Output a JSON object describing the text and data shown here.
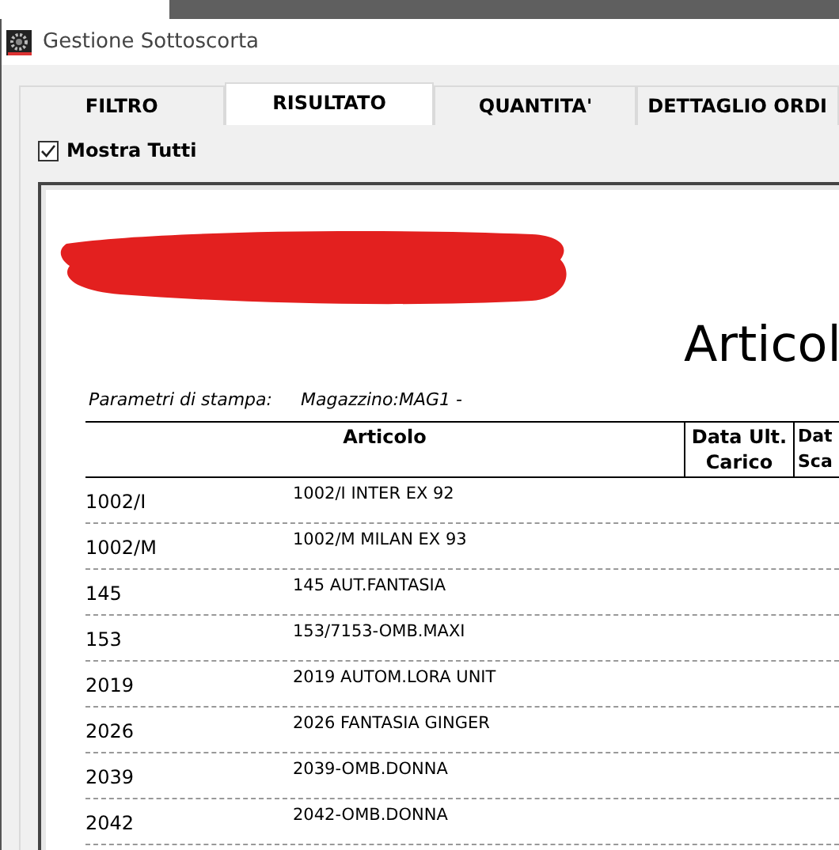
{
  "window": {
    "title": "Gestione Sottoscorta"
  },
  "tabs": [
    {
      "label": "FILTRO",
      "selected": false
    },
    {
      "label": "RISULTATO",
      "selected": true
    },
    {
      "label": "QUANTITA'",
      "selected": false
    },
    {
      "label": "DETTAGLIO ORDI",
      "selected": false
    }
  ],
  "show_all": {
    "label": "Mostra Tutti",
    "checked": true
  },
  "report": {
    "title": "Articol",
    "params_label": "Parametri di stampa:",
    "params_value": "Magazzino:MAG1  -",
    "columns": [
      {
        "lines": [
          "Articolo"
        ]
      },
      {
        "lines": [
          "Data Ult.",
          "Carico"
        ]
      },
      {
        "lines": [
          "Dat",
          "Sca"
        ]
      }
    ],
    "rows": [
      {
        "code": "1002/I",
        "description": "1002/I INTER EX 92"
      },
      {
        "code": "1002/M",
        "description": "1002/M MILAN EX 93"
      },
      {
        "code": "145",
        "description": "145 AUT.FANTASIA"
      },
      {
        "code": "153",
        "description": "153/7153-OMB.MAXI"
      },
      {
        "code": "2019",
        "description": "2019 AUTOM.LORA UNIT"
      },
      {
        "code": "2026",
        "description": "2026 FANTASIA GINGER"
      },
      {
        "code": "2039",
        "description": "2039-OMB.DONNA"
      },
      {
        "code": "2042",
        "description": "2042-OMB.DONNA"
      }
    ]
  }
}
